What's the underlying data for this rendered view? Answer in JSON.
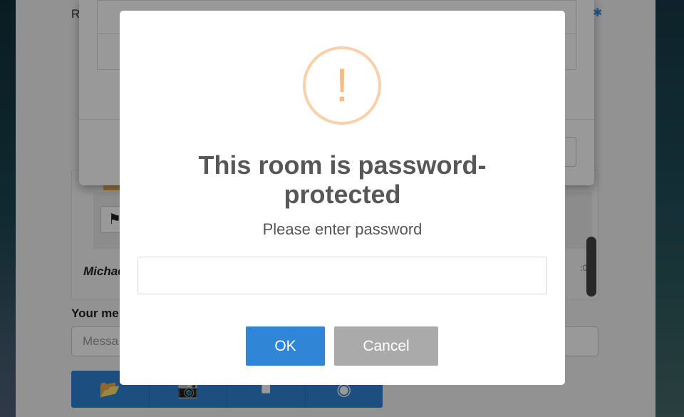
{
  "background_app": {
    "title": "R",
    "message_author": "Michae",
    "message_time": ":07",
    "flag_icon": "flag-icon",
    "message_label": "Your me",
    "message_placeholder": "Messa",
    "media_buttons": [
      {
        "icon": "folder-icon",
        "glyph": "📂"
      },
      {
        "icon": "camera-icon",
        "glyph": "📷"
      },
      {
        "icon": "video-icon",
        "glyph": "■"
      },
      {
        "icon": "record-icon",
        "glyph": "◉"
      }
    ]
  },
  "dialog": {
    "icon": "warning-icon",
    "icon_glyph": "!",
    "title": "This room is password-protected",
    "text": "Please enter password",
    "input_value": "",
    "ok_label": "OK",
    "cancel_label": "Cancel"
  },
  "colors": {
    "ok_button": "#3085d6",
    "cancel_button": "#aaaaaa",
    "warning_icon": "#f8bb86"
  }
}
